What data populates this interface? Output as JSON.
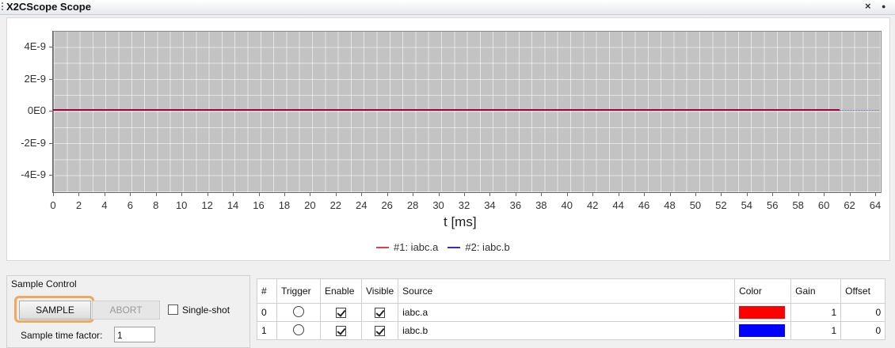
{
  "window": {
    "title": "X2CScope Scope",
    "close_glyph": "×",
    "pin_glyph": "●"
  },
  "plot": {
    "y_ticks": [
      "4E-9",
      "2E-9",
      "0E0",
      "-2E-9",
      "-4E-9"
    ],
    "x_ticks": [
      "0",
      "2",
      "4",
      "6",
      "8",
      "10",
      "12",
      "14",
      "16",
      "18",
      "20",
      "22",
      "24",
      "26",
      "28",
      "30",
      "32",
      "34",
      "36",
      "38",
      "40",
      "42",
      "44",
      "46",
      "48",
      "50",
      "52",
      "54",
      "56",
      "58",
      "60",
      "62",
      "64"
    ],
    "x_label": "t [ms]",
    "legend": [
      {
        "label": "#1: iabc.a",
        "color": "#e04040"
      },
      {
        "label": "#2: iabc.b",
        "color": "#3030c0"
      }
    ]
  },
  "sample_control": {
    "title": "Sample Control",
    "sample_label": "SAMPLE",
    "abort_label": "ABORT",
    "single_shot_label": "Single-shot",
    "time_factor_label": "Sample time factor:",
    "time_factor_value": "1"
  },
  "table": {
    "headers": [
      "#",
      "Trigger",
      "Enable",
      "Visible",
      "Source",
      "Color",
      "Gain",
      "Offset"
    ],
    "rows": [
      {
        "index": "0",
        "source": "iabc.a",
        "color": "#ff0000",
        "gain": "1",
        "offset": "0"
      },
      {
        "index": "1",
        "source": "iabc.b",
        "color": "#0000ff",
        "gain": "1",
        "offset": "0"
      }
    ]
  }
}
